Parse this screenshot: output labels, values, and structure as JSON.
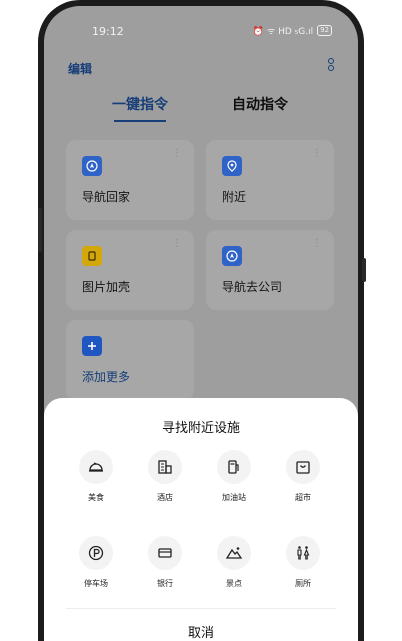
{
  "status_bar": {
    "time": "19:12",
    "icons": "⏰ ᯤ HD ₅G.ıl",
    "battery": "92"
  },
  "header": {
    "edit_label": "编辑"
  },
  "tabs": [
    {
      "label": "一键指令",
      "active": true
    },
    {
      "label": "自动指令",
      "active": false
    }
  ],
  "cards": [
    {
      "label": "导航回家",
      "icon": "navigation-icon",
      "color": "#2f63c8"
    },
    {
      "label": "附近",
      "icon": "location-pin-icon",
      "color": "#2f63c8"
    },
    {
      "label": "图片加壳",
      "icon": "image-frame-icon",
      "color": "#d2a80b"
    },
    {
      "label": "导航去公司",
      "icon": "navigation-icon",
      "color": "#2f63c8"
    }
  ],
  "add_card": {
    "label": "添加更多",
    "icon": "plus-icon",
    "color": "#1f56c2"
  },
  "sheet": {
    "title": "寻找附近设施",
    "facilities": [
      {
        "label": "美食",
        "icon": "food-cloche-icon"
      },
      {
        "label": "酒店",
        "icon": "hotel-icon"
      },
      {
        "label": "加油站",
        "icon": "gas-station-icon"
      },
      {
        "label": "超市",
        "icon": "supermarket-icon"
      },
      {
        "label": "停车场",
        "icon": "parking-icon"
      },
      {
        "label": "银行",
        "icon": "bank-card-icon"
      },
      {
        "label": "景点",
        "icon": "scenery-icon"
      },
      {
        "label": "厕所",
        "icon": "restroom-icon"
      }
    ],
    "cancel_label": "取消"
  }
}
